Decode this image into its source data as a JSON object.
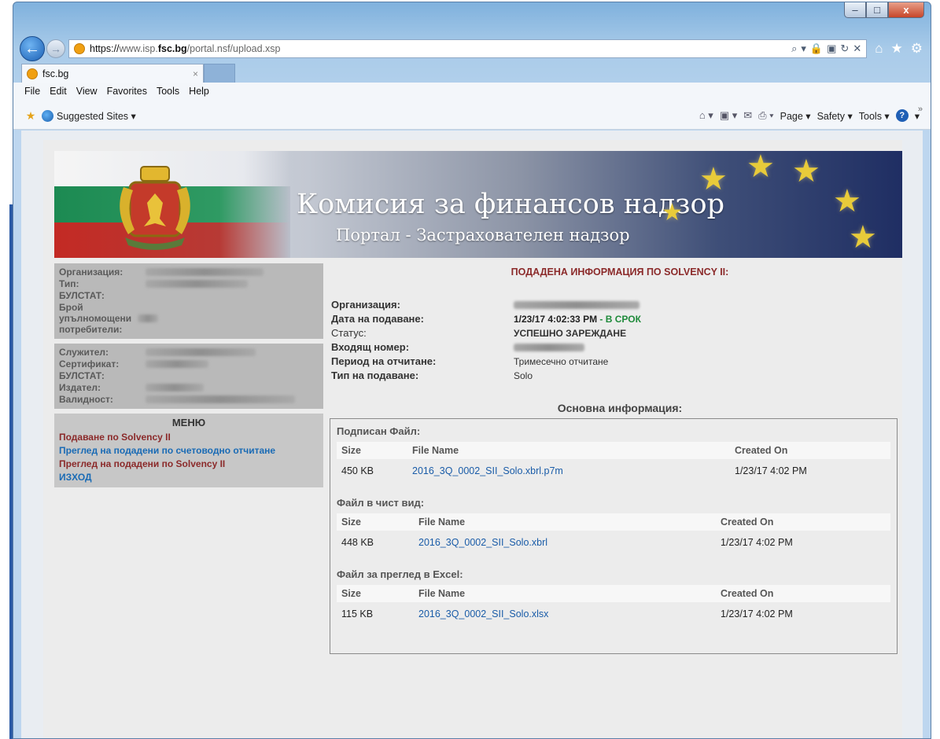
{
  "window": {
    "controls": {
      "minimize": "–",
      "maximize": "□",
      "close": "x"
    }
  },
  "addressbar": {
    "scheme": "https://",
    "prefix": "www.isp.",
    "host": "fsc.bg",
    "path": "/portal.nsf/upload.xsp",
    "tools": [
      "⌕",
      "▾",
      "🔒",
      "▣",
      "↻",
      "✕"
    ]
  },
  "tab": {
    "title": "fsc.bg",
    "close": "×"
  },
  "menubar": [
    "File",
    "Edit",
    "View",
    "Favorites",
    "Tools",
    "Help"
  ],
  "favorites": {
    "suggested": "Suggested Sites ▾"
  },
  "commandbar": {
    "page": "Page ▾",
    "safety": "Safety ▾",
    "tools": "Tools ▾"
  },
  "banner": {
    "title": "Комисия за финансов надзор",
    "subtitle": "Портал - Застрахователен надзор"
  },
  "sidebar": {
    "org_labels": [
      "Организация:",
      "Тип:",
      "БУЛСТАТ:",
      "Брой упълномощени потребители:"
    ],
    "cert_labels": [
      "Служител:",
      "Сертификат:",
      "БУЛСТАТ:",
      "Издател:",
      "Валидност:"
    ],
    "menu_title": "МЕНЮ",
    "menu": [
      "Подаване по Solvency II",
      "Преглед на подадени по счетоводно отчитане",
      "Преглед на подадени по Solvency II",
      "ИЗХОД"
    ]
  },
  "main": {
    "heading": "ПОДАДЕНА ИНФОРМАЦИЯ ПО SOLVENCY II:",
    "details": {
      "org_label": "Организация:",
      "date_label": "Дата на подаване:",
      "date_value": "1/23/17 4:02:33 PM",
      "date_ontime": "- В СРОК",
      "status_label": "Статус:",
      "status_value": "УСПЕШНО ЗАРЕЖДАНЕ",
      "incoming_label": "Входящ номер:",
      "period_label": "Период на отчитане:",
      "period_value": "Тримесечно отчитане",
      "type_label": "Тип на подаване:",
      "type_value": "Solo"
    },
    "section_title": "Основна информация:",
    "columns": {
      "size": "Size",
      "name": "File Name",
      "created": "Created On"
    },
    "groups": [
      {
        "title": "Подписан Файл:",
        "size": "450 KB",
        "name": "2016_3Q_0002_SII_Solo.xbrl.p7m",
        "created": "1/23/17 4:02 PM"
      },
      {
        "title": "Файл в чист вид:",
        "size": "448 KB",
        "name": "2016_3Q_0002_SII_Solo.xbrl",
        "created": "1/23/17 4:02 PM"
      },
      {
        "title": "Файл за преглед в Excel:",
        "size": "115 KB",
        "name": "2016_3Q_0002_SII_Solo.xlsx",
        "created": "1/23/17 4:02 PM"
      }
    ]
  },
  "colors": {
    "heading_red": "#8b2a2a",
    "link_blue": "#1a6bb5",
    "ok_green": "#1e8a3a"
  }
}
